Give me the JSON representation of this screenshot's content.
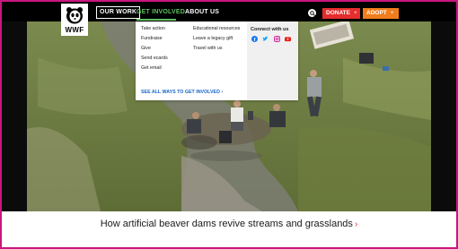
{
  "header": {
    "logo_text": "WWF",
    "nav": [
      {
        "label": "Our Work"
      },
      {
        "label": "Get Involved"
      },
      {
        "label": "About Us"
      }
    ],
    "buttons": {
      "donate": "Donate",
      "adopt": "Adopt",
      "plus": "+"
    }
  },
  "dropdown": {
    "column1": [
      "Take action",
      "Fundraise",
      "Give",
      "Send ecards",
      "Get email"
    ],
    "column2": [
      "Educational resources",
      "Leave a legacy gift",
      "Travel with us"
    ],
    "connect_title": "Connect with us",
    "see_all": "See all ways to get involved",
    "see_all_arrow": "›"
  },
  "caption": {
    "text": "How artificial beaver dams revive streams and grasslands",
    "arrow": "›"
  },
  "colors": {
    "accent_pink": "#c8177e",
    "nav_green": "#61c25f",
    "donate_red": "#e62d2d",
    "adopt_orange": "#f07d1d",
    "link_blue": "#1a66c9"
  },
  "icons": [
    "panda-logo",
    "search-icon",
    "facebook-icon",
    "twitter-icon",
    "instagram-icon",
    "youtube-icon"
  ]
}
